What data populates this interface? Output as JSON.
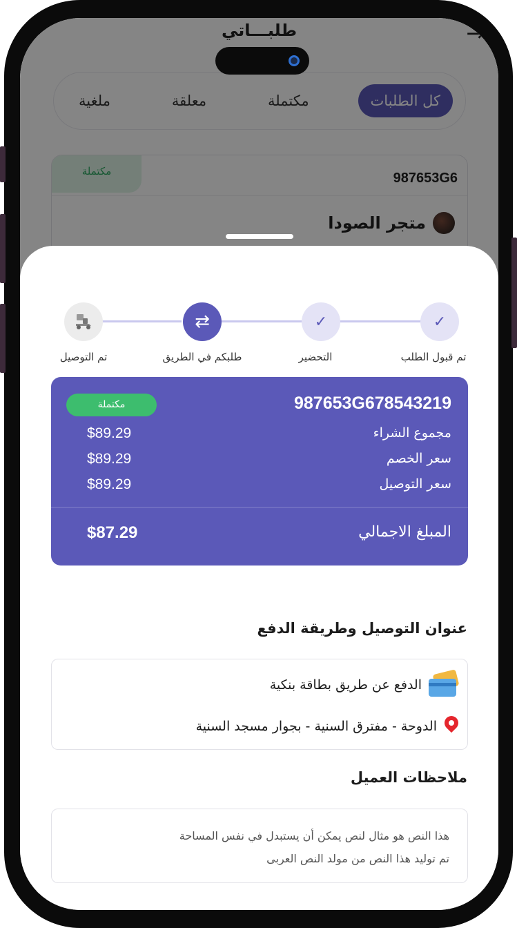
{
  "header": {
    "title": "طلبـــاتي",
    "back_icon": "arrow-right-icon"
  },
  "tabs": [
    {
      "label": "كل الطلبات",
      "active": true
    },
    {
      "label": "مكتملة",
      "active": false
    },
    {
      "label": "معلقة",
      "active": false
    },
    {
      "label": "ملغية",
      "active": false
    }
  ],
  "order_card": {
    "badge": "مكتملة",
    "order_id": "987653G6",
    "store_name": "متجر الصودا"
  },
  "stepper": {
    "steps": [
      {
        "label": "تم قبول الطلب",
        "state": "done",
        "icon": "check-icon"
      },
      {
        "label": "التحضير",
        "state": "done",
        "icon": "check-icon"
      },
      {
        "label": "طلبكم في الطريق",
        "state": "current",
        "icon": "swap-arrows-icon"
      },
      {
        "label": "تم التوصيل",
        "state": "pending",
        "icon": "delivery-scooter-icon"
      }
    ]
  },
  "summary": {
    "order_id": "987653G678543219",
    "status_badge": "مكتملة",
    "rows": [
      {
        "label": "مجموع الشراء",
        "value": "$89.29"
      },
      {
        "label": "سعر الخصم",
        "value": "$89.29"
      },
      {
        "label": "سعر التوصيل",
        "value": "$89.29"
      }
    ],
    "total_label": "المبلغ الاجمالي",
    "total_value": "$87.29"
  },
  "delivery": {
    "section_title": "عنوان التوصيل وطريقة الدفع",
    "payment_method": "الدفع عن طريق بطاقة بنكية",
    "address": "الدوحة - مفترق السنية - بجوار مسجد السنية"
  },
  "notes": {
    "section_title": "ملاحظات العميل",
    "line1": "هذا النص هو مثال لنص يمكن أن يستبدل في نفس المساحة",
    "line2": "تم توليد هذا النص من مولد النص العربى"
  },
  "colors": {
    "primary": "#5b59b8",
    "success": "#3dbd6e",
    "pin": "#e5262d"
  }
}
